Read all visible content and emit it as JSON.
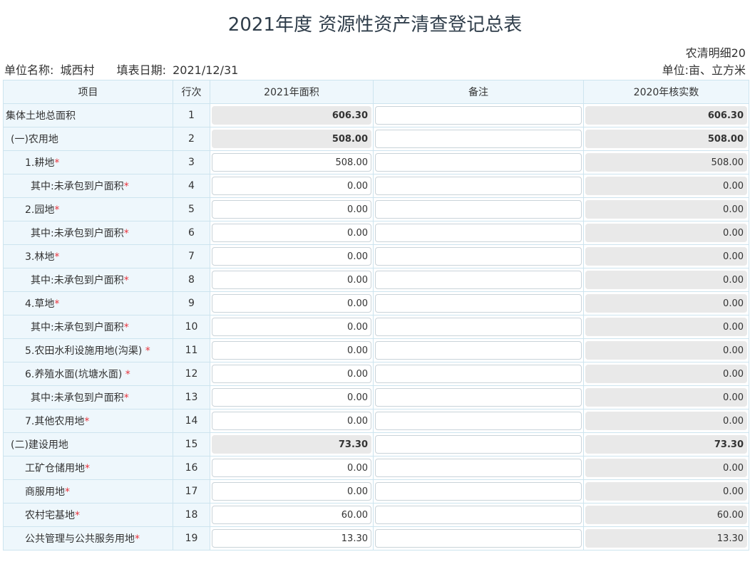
{
  "title": "2021年度 资源性资产清查登记总表",
  "form_code": "农清明细20",
  "unit_name_label": "单位名称:",
  "unit_name": "城西村",
  "fill_date_label": "填表日期:",
  "fill_date": "2021/12/31",
  "unit_text": "单位:亩、立方米",
  "columns": [
    "项目",
    "行次",
    "2021年面积",
    "备注",
    "2020年核实数"
  ],
  "rows": [
    {
      "label": "集体土地总面积",
      "req": "",
      "no": "1",
      "area": "606.30",
      "note": "",
      "verified": "606.30"
    },
    {
      "label": "(一)农用地",
      "req": "",
      "no": "2",
      "area": "508.00",
      "note": "",
      "verified": "508.00"
    },
    {
      "label": "1.耕地",
      "req": "*",
      "no": "3",
      "area": "508.00",
      "note": "",
      "verified": "508.00"
    },
    {
      "label": "其中:未承包到户面积",
      "req": "*",
      "no": "4",
      "area": "0.00",
      "note": "",
      "verified": "0.00"
    },
    {
      "label": "2.园地",
      "req": "*",
      "no": "5",
      "area": "0.00",
      "note": "",
      "verified": "0.00"
    },
    {
      "label": "其中:未承包到户面积",
      "req": "*",
      "no": "6",
      "area": "0.00",
      "note": "",
      "verified": "0.00"
    },
    {
      "label": "3.林地",
      "req": "*",
      "no": "7",
      "area": "0.00",
      "note": "",
      "verified": "0.00"
    },
    {
      "label": "其中:未承包到户面积",
      "req": "*",
      "no": "8",
      "area": "0.00",
      "note": "",
      "verified": "0.00"
    },
    {
      "label": "4.草地",
      "req": "*",
      "no": "9",
      "area": "0.00",
      "note": "",
      "verified": "0.00"
    },
    {
      "label": "其中:未承包到户面积",
      "req": "*",
      "no": "10",
      "area": "0.00",
      "note": "",
      "verified": "0.00"
    },
    {
      "label": "5.农田水利设施用地(沟渠)",
      "req": " *",
      "no": "11",
      "area": "0.00",
      "note": "",
      "verified": "0.00"
    },
    {
      "label": "6.养殖水面(坑塘水面)",
      "req": " *",
      "no": "12",
      "area": "0.00",
      "note": "",
      "verified": "0.00"
    },
    {
      "label": "其中:未承包到户面积",
      "req": "*",
      "no": "13",
      "area": "0.00",
      "note": "",
      "verified": "0.00"
    },
    {
      "label": "7.其他农用地",
      "req": "*",
      "no": "14",
      "area": "0.00",
      "note": "",
      "verified": "0.00"
    },
    {
      "label": "(二)建设用地",
      "req": "",
      "no": "15",
      "area": "73.30",
      "note": "",
      "verified": "73.30"
    },
    {
      "label": "工矿仓储用地",
      "req": "*",
      "no": "16",
      "area": "0.00",
      "note": "",
      "verified": "0.00"
    },
    {
      "label": "商服用地",
      "req": "*",
      "no": "17",
      "area": "0.00",
      "note": "",
      "verified": "0.00"
    },
    {
      "label": "农村宅基地",
      "req": "*",
      "no": "18",
      "area": "60.00",
      "note": "",
      "verified": "60.00"
    },
    {
      "label": "公共管理与公共服务用地",
      "req": "*",
      "no": "19",
      "area": "13.30",
      "note": "",
      "verified": "13.30"
    }
  ]
}
